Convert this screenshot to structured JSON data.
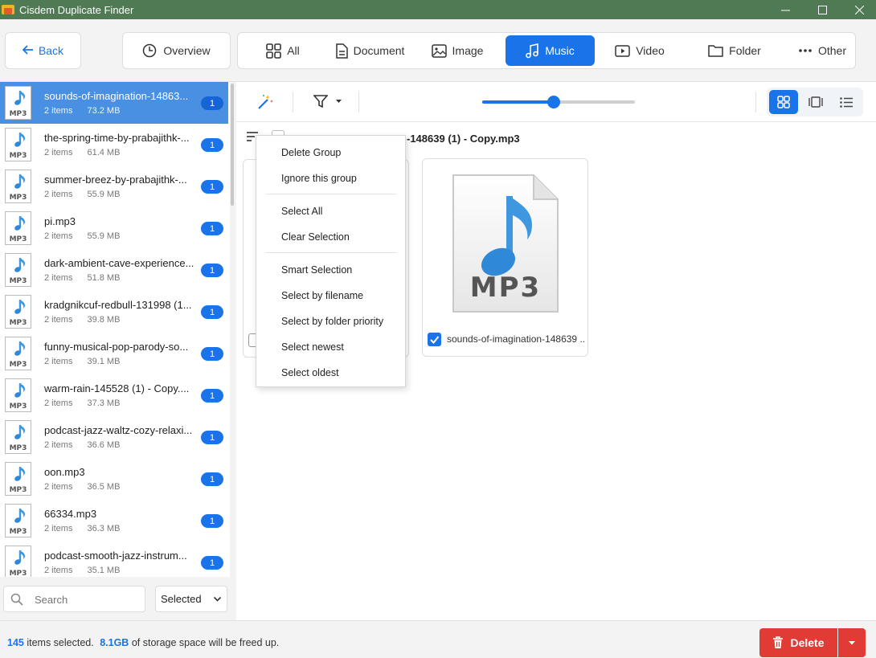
{
  "window": {
    "title": "Cisdem Duplicate Finder"
  },
  "nav": {
    "back_label": "Back",
    "overview_label": "Overview",
    "tabs": [
      {
        "label": "All",
        "icon": "grid-icon"
      },
      {
        "label": "Document",
        "icon": "document-icon"
      },
      {
        "label": "Image",
        "icon": "image-icon"
      },
      {
        "label": "Music",
        "icon": "music-note-icon",
        "active": true
      },
      {
        "label": "Video",
        "icon": "video-icon"
      },
      {
        "label": "Folder",
        "icon": "folder-icon"
      },
      {
        "label": "Other",
        "icon": "more-icon"
      }
    ]
  },
  "groups": [
    {
      "name": "sounds-of-imagination-14863...",
      "items": "2 items",
      "size": "73.2 MB",
      "count": "1",
      "selected": true
    },
    {
      "name": "the-spring-time-by-prabajithk-...",
      "items": "2 items",
      "size": "61.4 MB",
      "count": "1"
    },
    {
      "name": "summer-breez-by-prabajithk-...",
      "items": "2 items",
      "size": "55.9 MB",
      "count": "1"
    },
    {
      "name": "pi.mp3",
      "items": "2 items",
      "size": "55.9 MB",
      "count": "1"
    },
    {
      "name": "dark-ambient-cave-experience...",
      "items": "2 items",
      "size": "51.8 MB",
      "count": "1"
    },
    {
      "name": "kradgnikcuf-redbull-131998 (1...",
      "items": "2 items",
      "size": "39.8 MB",
      "count": "1"
    },
    {
      "name": "funny-musical-pop-parody-so...",
      "items": "2 items",
      "size": "39.1 MB",
      "count": "1"
    },
    {
      "name": "warm-rain-145528 (1) - Copy....",
      "items": "2 items",
      "size": "37.3 MB",
      "count": "1"
    },
    {
      "name": "podcast-jazz-waltz-cozy-relaxi...",
      "items": "2 items",
      "size": "36.6 MB",
      "count": "1"
    },
    {
      "name": "oon.mp3",
      "items": "2 items",
      "size": "36.5 MB",
      "count": "1"
    },
    {
      "name": "66334.mp3",
      "items": "2 items",
      "size": "36.3 MB",
      "count": "1"
    },
    {
      "name": "podcast-smooth-jazz-instrum...",
      "items": "2 items",
      "size": "35.1 MB",
      "count": "1"
    }
  ],
  "thumb_label": "MP3",
  "search": {
    "placeholder": "Search",
    "filter_value": "Selected"
  },
  "content": {
    "group_header": "-148639 (1) - Copy.mp3",
    "card2_name": "sounds-of-imagination-148639 ...",
    "card_big_label": "MP3"
  },
  "slider": {
    "value": 0.47
  },
  "context_menu": {
    "delete_group": "Delete Group",
    "ignore_group": "Ignore this group",
    "select_all": "Select All",
    "clear_selection": "Clear Selection",
    "smart_selection": "Smart Selection",
    "select_by_filename": "Select by filename",
    "select_by_folder_priority": "Select by folder priority",
    "select_newest": "Select newest",
    "select_oldest": "Select oldest"
  },
  "status": {
    "count": "145",
    "count_text": "items selected.",
    "size": "8.1GB",
    "size_text": "of storage space will be freed up."
  },
  "delete_label": "Delete",
  "colors": {
    "accent": "#1a73e8",
    "titlebar": "#4f7a53",
    "delete": "#e03b35"
  }
}
